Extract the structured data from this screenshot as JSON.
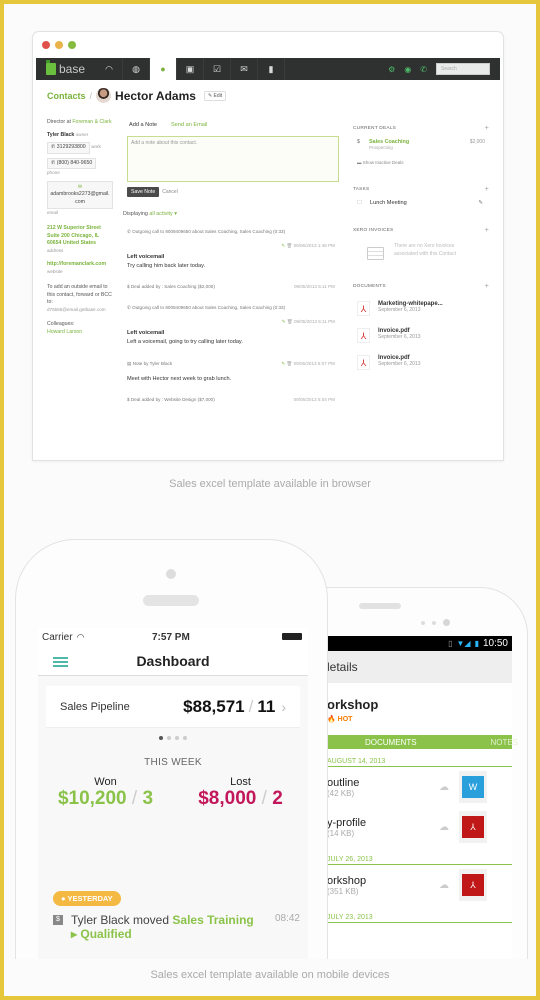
{
  "browser": {
    "logo_text": "base",
    "nav_icons": [
      "speedometer-icon",
      "globe-icon",
      "contacts-icon",
      "leads-icon",
      "tasks-icon",
      "mail-icon",
      "reports-icon"
    ],
    "nav_icon_glyphs": [
      "◠",
      "◍",
      "●",
      "▣",
      "☑",
      "✉",
      "▮"
    ],
    "right_icons": [
      "⚙",
      "◉",
      "✆"
    ],
    "search_placeholder": "Search",
    "breadcrumb": {
      "parent": "Contacts",
      "separator": "/",
      "name": "Hector Adams",
      "edit_label": "✎ Edit"
    },
    "contact": {
      "title_prefix": "Director at",
      "company": "Foreman & Clark",
      "owner_name": "Tyler Black",
      "owner_label": "owner",
      "phones": [
        {
          "number": "3129293800",
          "label": "work"
        },
        {
          "number": "(800) 840-9650",
          "label": "phone"
        }
      ],
      "email": "adambrooks2273@gmail.com",
      "email_label": "email",
      "address": "212 W Superior Street Suite 200 Chicago, IL 60654 United States",
      "address_label": "address",
      "website": "http://foremanclark.com",
      "website_label": "website",
      "bcc_text": "To add an outside email to this contact, forward or BCC to:",
      "bcc_address": "d76555@email.getbase.com",
      "colleagues_label": "Colleagues:",
      "colleague": "Howard Larson"
    },
    "note": {
      "tab_note": "Add a Note",
      "tab_email": "Send an Email",
      "placeholder": "Add a note about this contact.",
      "save_label": "Save Note",
      "cancel_label": "Cancel"
    },
    "displaying": {
      "prefix": "Displaying",
      "filter": "all activity ▾"
    },
    "activity": [
      {
        "type": "call",
        "text": "Outgoing call to 8009409650 about Sales Coaching, Sales Coaching (0:33)",
        "time": "09/06/2013 1:48 PM",
        "title": "Left voicemail",
        "body": "Try calling him back later today."
      },
      {
        "type": "deal",
        "text": "Deal added by : Sales Coaching ($2,000)",
        "time": "09/05/2013 5:11 PM"
      },
      {
        "type": "call",
        "text": "Outgoing call to 8009409650 about Sales Coaching, Sales Coaching (0:33)",
        "time": "09/05/2013 5:11 PM",
        "title": "Left voicemail",
        "body": "Left a voicemail, going to try calling later today."
      },
      {
        "type": "note",
        "text": "Note by Tyler Black",
        "time": "09/05/2013 5:07 PM",
        "body": "Meet with Hector next week to grab lunch."
      },
      {
        "type": "deal",
        "text": "Deal added by : Website Design ($7,000)",
        "time": "09/05/2013 5:04 PM"
      }
    ],
    "sidebar": {
      "deals_heading": "CURRENT DEALS",
      "deal_name": "Sales Coaching",
      "deal_stage": "Prospecting",
      "deal_amount": "$2,000",
      "show_inactive": "Show Inactive Deals",
      "tasks_heading": "TASKS",
      "task": "Lunch Meeting",
      "xero_heading": "XERO INVOICES",
      "xero_empty": "There are no Xero Invoices associated with this Contact",
      "documents_heading": "DOCUMENTS",
      "documents": [
        {
          "name": "Marketing-whitepape...",
          "date": "September 6, 2013"
        },
        {
          "name": "Invoice.pdf",
          "date": "September 6, 2013"
        },
        {
          "name": "Invoice.pdf",
          "date": "September 6, 2013"
        }
      ]
    }
  },
  "captions": {
    "browser": "Sales excel template available in browser",
    "mobile": "Sales excel template available on mobile devices"
  },
  "iphone": {
    "carrier": "Carrier",
    "time": "7:57 PM",
    "title": "Dashboard",
    "pipeline_label": "Sales Pipeline",
    "pipeline_value": "$88,571",
    "pipeline_count": "11",
    "pager_pages": 4,
    "pager_active": 1,
    "week_label": "THIS WEEK",
    "won_label": "Won",
    "won_value": "$10,200",
    "won_count": "3",
    "lost_label": "Lost",
    "lost_value": "$8,000",
    "lost_count": "2",
    "badge": "● YESTERDAY",
    "feed_text": "Tyler Black moved",
    "feed_deal": "Sales Training",
    "feed_stage": "▸ Qualified",
    "feed_time": "08:42",
    "colors": {
      "accent": "#4fb8a6",
      "won": "#8bc34a",
      "lost": "#c2185b",
      "badge": "#f4b942"
    }
  },
  "android": {
    "time": "10:50",
    "header": "letails",
    "title": "orkshop",
    "hot": "🔥 HOT",
    "tab_documents": "DOCUMENTS",
    "tab_notes": "NOTES",
    "groups": [
      {
        "date": "AUGUST 14, 2013",
        "docs": [
          {
            "name": "outline",
            "size": "(42 KB)",
            "type": "word"
          },
          {
            "name": "y-profile",
            "size": "(14 KB)",
            "type": "pdf"
          }
        ]
      },
      {
        "date": "JULY 26, 2013",
        "docs": [
          {
            "name": "orkshop",
            "size": "(351 KB)",
            "type": "pdf"
          }
        ]
      },
      {
        "date": "JULY 23, 2013",
        "docs": []
      }
    ],
    "colors": {
      "accent": "#8bc34a"
    }
  }
}
